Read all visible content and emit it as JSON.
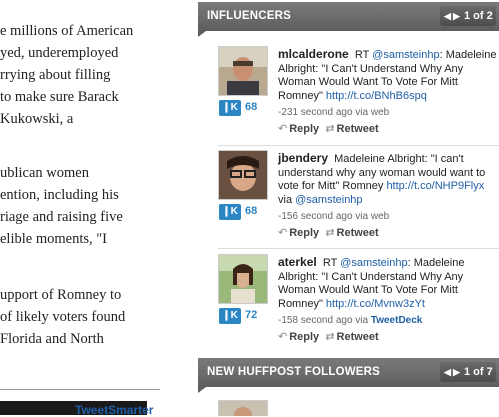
{
  "article": {
    "lines": [
      "e millions of American",
      "yed, underemployed",
      "rrying about filling",
      "to make sure Barack",
      "Kukowski, a",
      "ublican women",
      "ention, including his",
      "riage and raising five",
      "elible moments, \"I",
      "upport of Romney to",
      " of likely voters found",
      "Florida and North"
    ]
  },
  "influencers": {
    "title": "INFLUENCERS",
    "page": "1 of 2",
    "tweets": [
      {
        "user": "mlcalderone",
        "text_pre": "RT ",
        "mention": "@samsteinhp",
        "text": ": Madeleine Albright: \"I Can't Understand Why Any Woman Would Want To Vote For Mitt Romney\" ",
        "link": "http://t.co/BNhB6spq",
        "meta": "-231 second ago via web",
        "via_link": "",
        "klout": "68",
        "reply": "Reply",
        "retweet": "Retweet"
      },
      {
        "user": "jbendery",
        "text_pre": "",
        "mention": "",
        "text": "Madeleine Albright: \"I can't understand why any woman would want to vote for Mitt\" Romney ",
        "link": "http://t.co/NHP9Flyx",
        "via": " via ",
        "via_mention": "@samsteinhp",
        "meta": "-156 second ago via web",
        "via_link": "",
        "klout": "68",
        "reply": "Reply",
        "retweet": "Retweet"
      },
      {
        "user": "aterkel",
        "text_pre": "RT ",
        "mention": "@samsteinhp",
        "text": ": Madeleine Albright: \"I Can't Understand Why Any Woman Would Want To Vote For Mitt Romney\" ",
        "link": "http://t.co/Mvnw3zYt",
        "meta": "-158 second ago via ",
        "via_link": "TweetDeck",
        "klout": "72",
        "reply": "Reply",
        "retweet": "Retweet"
      }
    ]
  },
  "followers": {
    "title": "NEW HUFFPOST FOLLOWERS",
    "page": "1 of 7",
    "first_name": "TweetSmarter"
  },
  "icons": {
    "reply": "reply-arrow-icon",
    "retweet": "retweet-icon",
    "klout": "klout-logo-icon",
    "prev": "chevron-left-icon",
    "next": "chevron-right-icon"
  },
  "colors": {
    "header": "#666666",
    "link": "#1f5fa6",
    "klout": "#2d86c4"
  }
}
